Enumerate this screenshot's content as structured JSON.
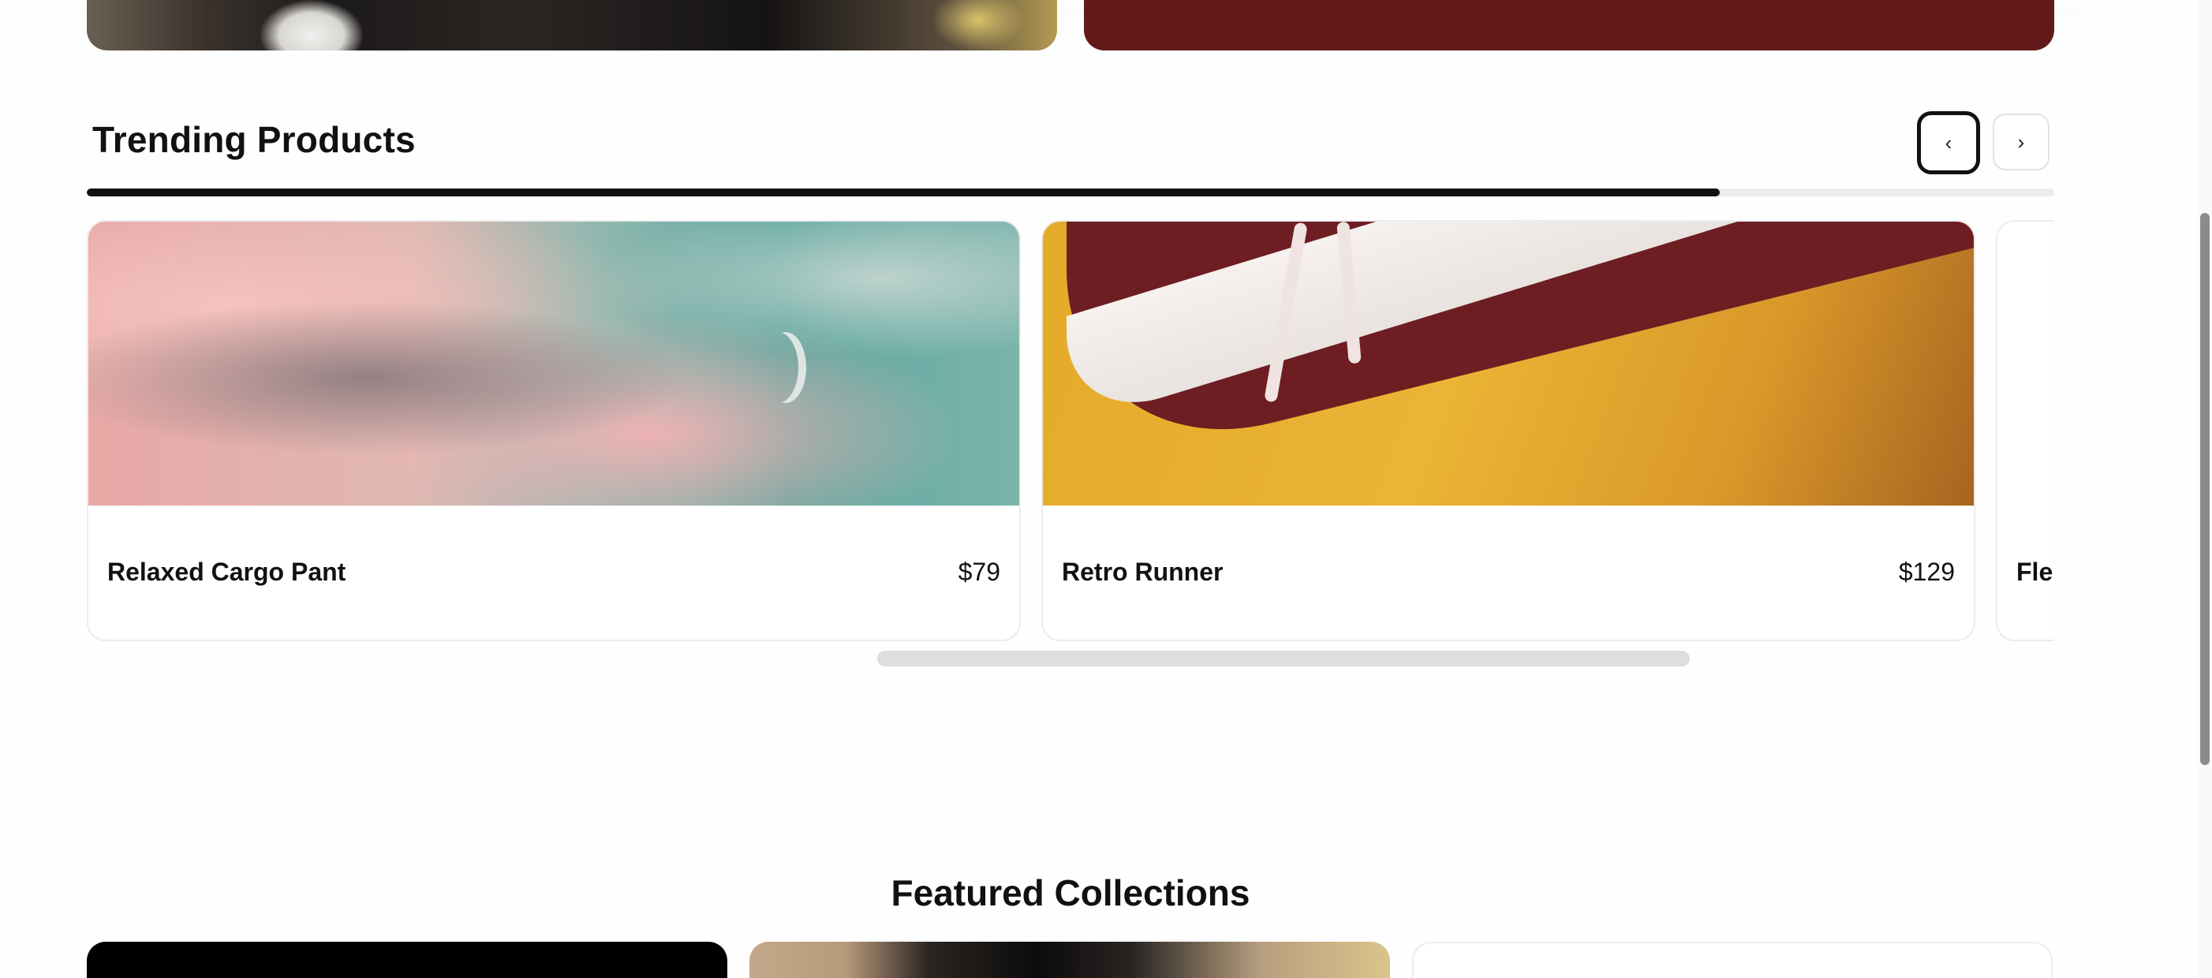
{
  "trending": {
    "title": "Trending Products",
    "prev_label": "‹",
    "next_label": "›",
    "progress_fraction": 0.83,
    "products": [
      {
        "name": "Relaxed Cargo Pant",
        "price": "$79"
      },
      {
        "name": "Retro Runner",
        "price": "$129"
      },
      {
        "name": "Fle",
        "price": ""
      }
    ]
  },
  "featured": {
    "title": "Featured Collections"
  },
  "colors": {
    "banner_right": "#621a1b",
    "accent": "#111111"
  }
}
